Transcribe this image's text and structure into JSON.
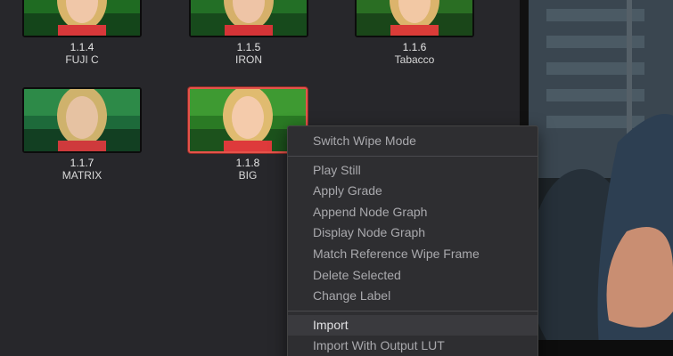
{
  "stills": [
    {
      "id": "1.1.4",
      "label": "FUJI C",
      "selected": false
    },
    {
      "id": "1.1.5",
      "label": "IRON",
      "selected": false
    },
    {
      "id": "1.1.6",
      "label": "Tabacco",
      "selected": false
    },
    {
      "id": "1.1.7",
      "label": "MATRIX",
      "selected": false
    },
    {
      "id": "1.1.8",
      "label": "BIG",
      "selected": true
    }
  ],
  "context_menu": {
    "items": [
      {
        "label": "Switch Wipe Mode"
      },
      {
        "label": "Play Still"
      },
      {
        "label": "Apply Grade"
      },
      {
        "label": "Append Node Graph"
      },
      {
        "label": "Display Node Graph"
      },
      {
        "label": "Match Reference Wipe Frame"
      },
      {
        "label": "Delete Selected"
      },
      {
        "label": "Change Label"
      },
      {
        "label": "Import"
      },
      {
        "label": "Import With Output LUT"
      }
    ],
    "active_item": "Import"
  },
  "colors": {
    "gallery_bg": "#27272b",
    "menu_bg": "#2e2e31",
    "selected_border": "#e5534b"
  }
}
